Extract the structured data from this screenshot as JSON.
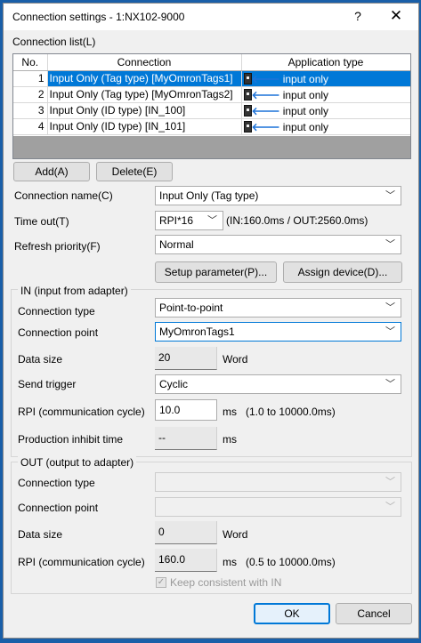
{
  "window": {
    "title": "Connection settings  - 1:NX102-9000",
    "help_label": "?",
    "close_label": "✕"
  },
  "connection_list": {
    "label": "Connection list(L)",
    "columns": [
      "No.",
      "Connection",
      "Application type"
    ],
    "rows": [
      {
        "no": "1",
        "connection": "Input Only (Tag type) [MyOmronTags1]",
        "app_type": "input only",
        "selected": true
      },
      {
        "no": "2",
        "connection": "Input Only (Tag type) [MyOmronTags2]",
        "app_type": "input only",
        "selected": false
      },
      {
        "no": "3",
        "connection": "Input Only (ID type) [IN_100]",
        "app_type": "input only",
        "selected": false
      },
      {
        "no": "4",
        "connection": "Input Only (ID type) [IN_101]",
        "app_type": "input only",
        "selected": false
      }
    ]
  },
  "buttons": {
    "add": "Add(A)",
    "delete": "Delete(E)",
    "setup_parameter": "Setup parameter(P)...",
    "assign_device": "Assign device(D)...",
    "ok": "OK",
    "cancel": "Cancel"
  },
  "general": {
    "connection_name_label": "Connection name(C)",
    "connection_name_value": "Input Only (Tag type)",
    "timeout_label": "Time out(T)",
    "timeout_value": "RPI*16",
    "timeout_info": "(IN:160.0ms / OUT:2560.0ms)",
    "refresh_priority_label": "Refresh priority(F)",
    "refresh_priority_value": "Normal"
  },
  "in_group": {
    "title": "IN (input from adapter)",
    "connection_type_label": "Connection type",
    "connection_type_value": "Point-to-point",
    "connection_point_label": "Connection point",
    "connection_point_value": "MyOmronTags1",
    "data_size_label": "Data size",
    "data_size_value": "20",
    "data_size_unit": "Word",
    "send_trigger_label": "Send trigger",
    "send_trigger_value": "Cyclic",
    "rpi_label": "RPI (communication cycle)",
    "rpi_value": "10.0",
    "rpi_unit": "ms",
    "rpi_range": "(1.0 to 10000.0ms)",
    "inhibit_label": "Production inhibit time",
    "inhibit_value": "--",
    "inhibit_unit": "ms"
  },
  "out_group": {
    "title": "OUT (output to adapter)",
    "connection_type_label": "Connection type",
    "connection_point_label": "Connection point",
    "data_size_label": "Data size",
    "data_size_value": "0",
    "data_size_unit": "Word",
    "rpi_label": "RPI (communication cycle)",
    "rpi_value": "160.0",
    "rpi_unit": "ms",
    "rpi_range": "(0.5 to 10000.0ms)",
    "keep_consistent_label": "Keep consistent with IN",
    "keep_consistent_checked": true
  },
  "colors": {
    "selection": "#0078d7",
    "dialog_bg": "#f0f0f0",
    "desktop": "#1a5fa8"
  }
}
